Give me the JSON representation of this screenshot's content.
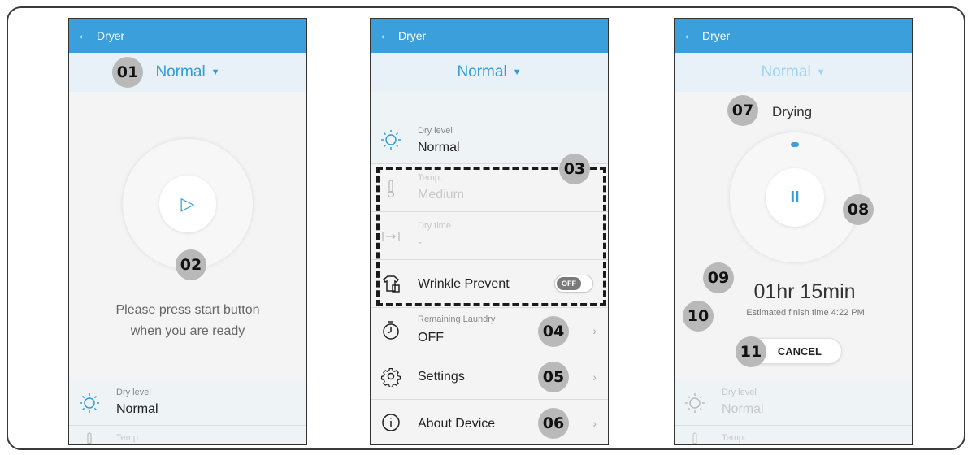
{
  "screens": [
    {
      "appbar": {
        "back_icon": "←",
        "title": "Dryer"
      },
      "mode": {
        "label": "Normal",
        "caret": "▼"
      },
      "start_icon": "▷",
      "message": {
        "line1": "Please press start button",
        "line2": "when you are ready"
      },
      "settings": [
        {
          "label": "Dry level",
          "value": "Normal"
        },
        {
          "label": "Temp."
        }
      ],
      "badges": [
        "01",
        "02"
      ]
    },
    {
      "appbar": {
        "back_icon": "←",
        "title": "Dryer"
      },
      "mode": {
        "label": "Normal",
        "caret": "▼"
      },
      "settings": [
        {
          "label": "Dry level",
          "value": "Normal"
        },
        {
          "label": "Temp.",
          "value": "Medium"
        },
        {
          "label": "Dry time",
          "value": "-"
        },
        {
          "value": "Wrinkle Prevent",
          "toggle": "OFF"
        },
        {
          "label": "Remaining Laundry",
          "value": "OFF"
        }
      ],
      "menu": [
        {
          "label": "Settings"
        },
        {
          "label": "About Device"
        }
      ],
      "chevron": "›",
      "badges": [
        "03",
        "04",
        "05",
        "06"
      ]
    },
    {
      "appbar": {
        "back_icon": "←",
        "title": "Dryer"
      },
      "mode": {
        "label": "Normal",
        "caret": "▼"
      },
      "status": "Drying",
      "pause_icon": "II",
      "time_remaining": "01hr 15min",
      "estimated_finish": "Estimated finish time 4:22 PM",
      "cancel_label": "CANCEL",
      "settings": [
        {
          "label": "Dry level",
          "value": "Normal"
        },
        {
          "label": "Temp."
        }
      ],
      "badges": [
        "07",
        "08",
        "09",
        "10",
        "11"
      ]
    }
  ],
  "colors": {
    "accent": "#3b9fdc",
    "badge": "#b9b9b9"
  }
}
